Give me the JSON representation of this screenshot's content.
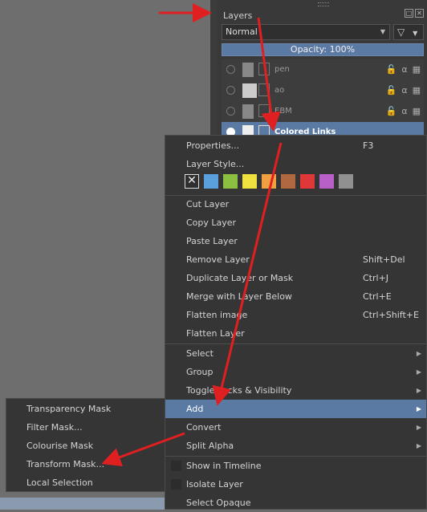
{
  "docker": {
    "title": "Layers",
    "blend_mode": "Normal",
    "opacity_label": "Opacity:  100%",
    "layers": [
      {
        "name": "pen"
      },
      {
        "name": "ao"
      },
      {
        "name": "EBM"
      },
      {
        "name": "Colored Links"
      }
    ]
  },
  "context_menu": {
    "properties": {
      "label": "Properties...",
      "shortcut": "F3"
    },
    "layer_style": {
      "label": "Layer Style..."
    },
    "colors": [
      "#5aa0dc",
      "#8cc040",
      "#f0e040",
      "#f0a040",
      "#b06840",
      "#e03838",
      "#b860c8",
      "#909090"
    ],
    "cut_layer": {
      "label": "Cut Layer"
    },
    "copy_layer": {
      "label": "Copy Layer"
    },
    "paste_layer": {
      "label": "Paste Layer"
    },
    "remove_layer": {
      "label": "Remove Layer",
      "shortcut": "Shift+Del"
    },
    "duplicate_layer": {
      "label": "Duplicate Layer or Mask",
      "shortcut": "Ctrl+J"
    },
    "merge_down": {
      "label": "Merge with Layer Below",
      "shortcut": "Ctrl+E"
    },
    "flatten_image": {
      "label": "Flatten image",
      "shortcut": "Ctrl+Shift+E"
    },
    "flatten_layer": {
      "label": "Flatten Layer"
    },
    "select": {
      "label": "Select"
    },
    "group": {
      "label": "Group"
    },
    "toggle_locks": {
      "label": "Toggle Locks & Visibility"
    },
    "add": {
      "label": "Add"
    },
    "convert": {
      "label": "Convert"
    },
    "split_alpha": {
      "label": "Split Alpha"
    },
    "show_in_timeline": {
      "label": "Show in Timeline"
    },
    "isolate_layer": {
      "label": "Isolate Layer"
    },
    "select_opaque": {
      "label": "Select Opaque"
    }
  },
  "add_submenu": {
    "items": [
      {
        "label": "Transparency Mask"
      },
      {
        "label": "Filter Mask..."
      },
      {
        "label": "Colourise Mask"
      },
      {
        "label": "Transform Mask..."
      },
      {
        "label": "Local Selection"
      }
    ]
  },
  "annotation_color": "#e02020"
}
